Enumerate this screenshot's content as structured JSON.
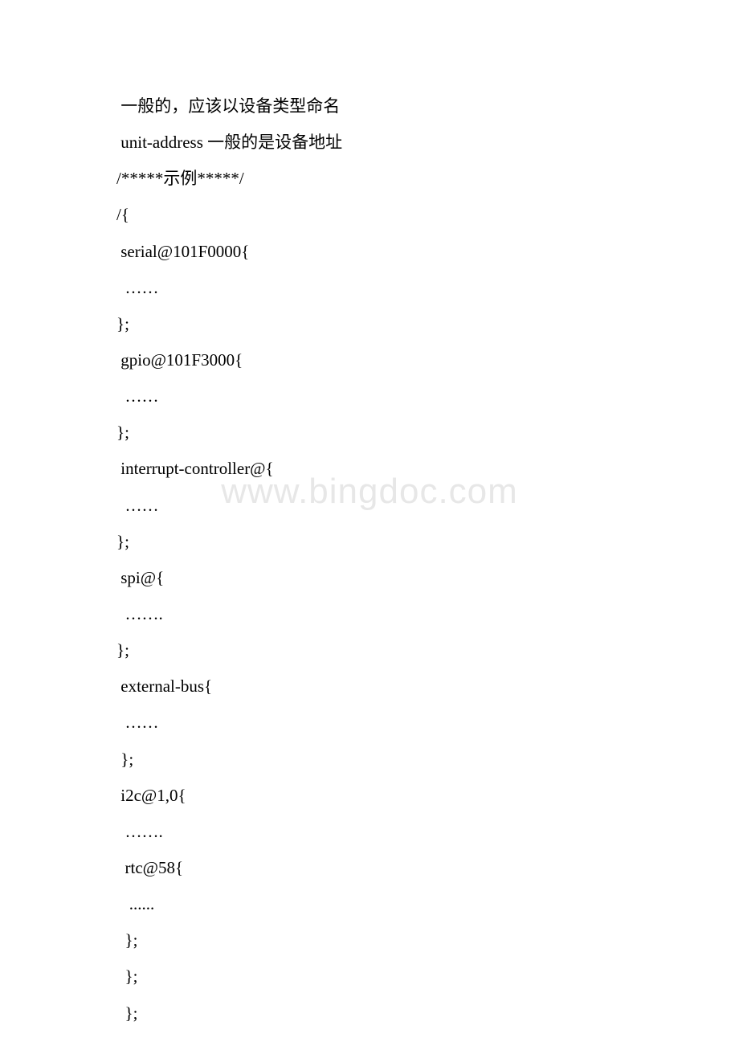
{
  "watermark": "www.bingdoc.com",
  "lines": [
    " 一般的，应该以设备类型命名",
    " unit-address 一般的是设备地址",
    "/*****示例*****/",
    "/{",
    " serial@101F0000{",
    "  ……",
    "};",
    " gpio@101F3000{",
    "  ……",
    "};",
    " interrupt-controller@{",
    "  ……",
    "};",
    " spi@{",
    "  …….",
    "};",
    " external-bus{",
    "  ……",
    " };",
    " i2c@1,0{",
    "  …….",
    "  rtc@58{",
    "   ......",
    "  };",
    "  };",
    "  };"
  ]
}
